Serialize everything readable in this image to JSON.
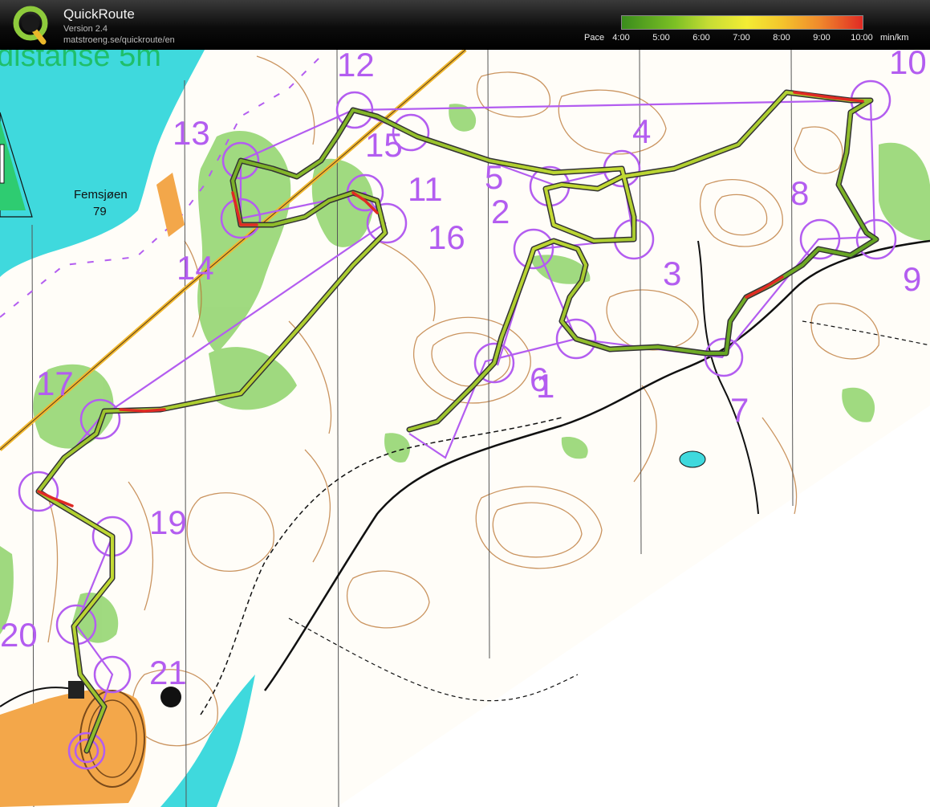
{
  "app": {
    "name": "QuickRoute",
    "version": "Version 2.4",
    "url": "matstroeng.se/quickroute/en"
  },
  "pace_legend": {
    "label": "Pace",
    "ticks": [
      "4:00",
      "5:00",
      "6:00",
      "7:00",
      "8:00",
      "9:00",
      "10:00"
    ],
    "unit": "min/km",
    "colors": [
      "#3a8c1c",
      "#7cc024",
      "#c6dc34",
      "#f4ec34",
      "#f4c62c",
      "#f08a2c",
      "#e02a24"
    ]
  },
  "map": {
    "title_fragment": "distanse 5m",
    "lake_name": "Femsjøen",
    "lake_elevation": "79",
    "control_labels": [
      "1",
      "2",
      "3",
      "4",
      "5",
      "6",
      "7",
      "8",
      "9",
      "10",
      "11",
      "12",
      "13",
      "14",
      "15",
      "16",
      "17",
      "19",
      "20",
      "21"
    ],
    "colors": {
      "water": "#3fd9dd",
      "forest": "#8fd36b",
      "contours": "#b9722e",
      "course": "#b35df0",
      "route_slow": "#e02a24",
      "route_fast": "#3a8c1c"
    }
  }
}
